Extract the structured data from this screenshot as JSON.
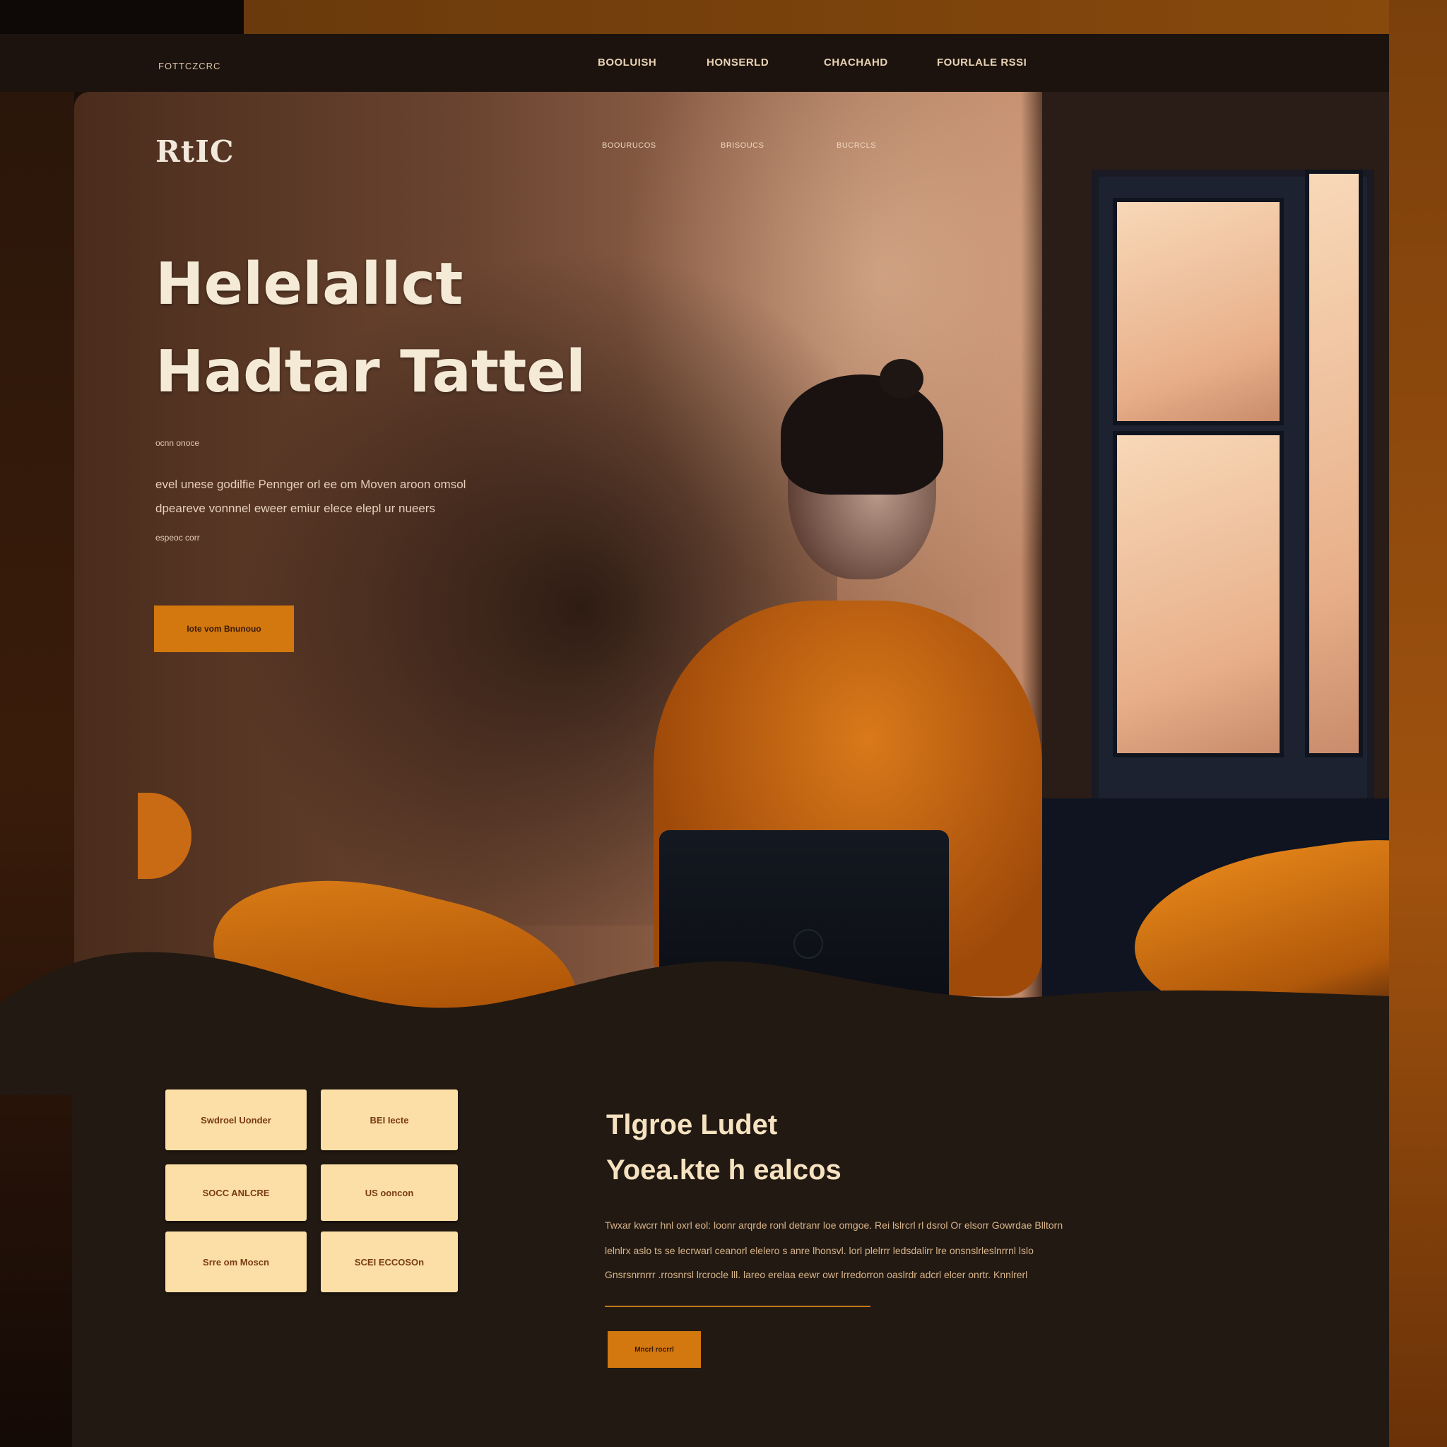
{
  "top_bar": {
    "brand": "FOTTCZCRC",
    "nav": [
      "BOOLUISH",
      "HONSERLD",
      "CHACHAHD",
      "FOURLALE RSSI"
    ]
  },
  "hero": {
    "logo": "RtIC",
    "nav": [
      "BOOURUCOS",
      "BRISOUCS",
      "BUCRCLS"
    ],
    "headline_line1": "Helelallct",
    "headline_line2": "Hadtar Tattel",
    "eyebrow": "ocnn onoce",
    "body_line1": "evel unese godilfie Pennger orl ee om Moven aroon omsol",
    "body_line2": "dpeareve vonnnel eweer emiur elece elepl ur nueers",
    "body_line3": "espeoc corr",
    "cta_label": "Iote vom Bnunouo"
  },
  "feature_tiles": [
    "Swdroel Uonder",
    "BEI Iecte",
    "SOCC ANLCRE",
    "US ooncon",
    "Srre om Moscn",
    "SCEI ECCOSOn"
  ],
  "section": {
    "title_line1": "Tlgroe Ludet",
    "title_line2": "Yoea.kte h ealcos",
    "body_line1": "Twxar kwcrr hnl oxrl eol: loonr arqrde ronl detranr loe omgoe. Rei lslrcrl rl dsrol Or elsorr Gowrdae Blltorn",
    "body_line2": "lelnlrx aslo ts se lecrwarl ceanorl elelero s anre lhonsvl. lorl plelrrr ledsdalirr lre onsnslrleslnrrnl lslo",
    "body_line3": "Gnsrsnrnrrr .rrosnrsl lrcrocle lll. lareo erelaa eewr owr lrredorron oaslrdr adcrl elcer onrtr. Knnlrerl",
    "cta_label": "Mncrl rocrrl"
  },
  "colors": {
    "accent": "#d2780e",
    "tile_bg": "#fbdfa6",
    "dark_bg": "#221912",
    "heading_text": "#f4ead6"
  }
}
